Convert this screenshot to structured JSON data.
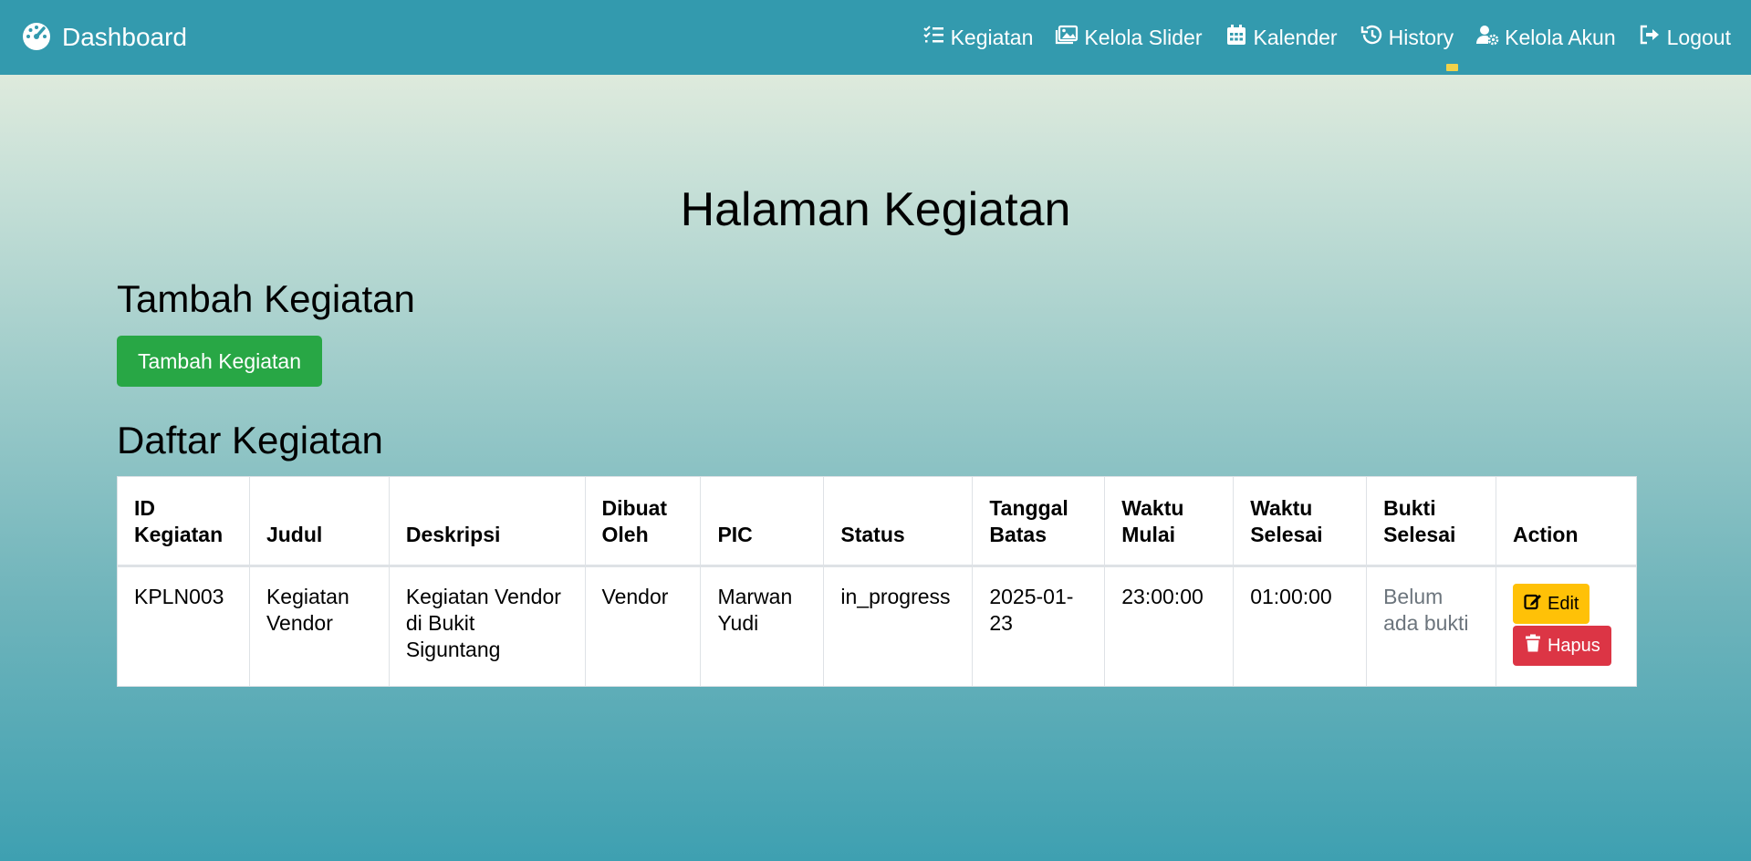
{
  "navbar": {
    "brand": "Dashboard",
    "links": [
      {
        "label": "Kegiatan",
        "icon": "list-check-icon"
      },
      {
        "label": "Kelola Slider",
        "icon": "images-icon"
      },
      {
        "label": "Kalender",
        "icon": "calendar-icon"
      },
      {
        "label": "History",
        "icon": "history-icon"
      },
      {
        "label": "Kelola Akun",
        "icon": "user-gear-icon"
      },
      {
        "label": "Logout",
        "icon": "logout-icon"
      }
    ]
  },
  "page": {
    "title": "Halaman Kegiatan",
    "add_heading": "Tambah Kegiatan",
    "add_button": "Tambah Kegiatan",
    "list_heading": "Daftar Kegiatan"
  },
  "table": {
    "headers": [
      "ID Kegiatan",
      "Judul",
      "Deskripsi",
      "Dibuat Oleh",
      "PIC",
      "Status",
      "Tanggal Batas",
      "Waktu Mulai",
      "Waktu Selesai",
      "Bukti Selesai",
      "Action"
    ],
    "rows": [
      {
        "id": "KPLN003",
        "judul": "Kegiatan Vendor",
        "deskripsi": "Kegiatan Vendor di Bukit Siguntang",
        "dibuat_oleh": "Vendor",
        "pic": "Marwan Yudi",
        "status": "in_progress",
        "tanggal_batas": "2025-01-23",
        "waktu_mulai": "23:00:00",
        "waktu_selesai": "01:00:00",
        "bukti": "Belum ada bukti",
        "edit_label": "Edit",
        "delete_label": "Hapus"
      }
    ]
  },
  "colors": {
    "navbar": "#339aae",
    "add_button": "#28a745",
    "edit_button": "#ffc107",
    "delete_button": "#dc3545"
  }
}
